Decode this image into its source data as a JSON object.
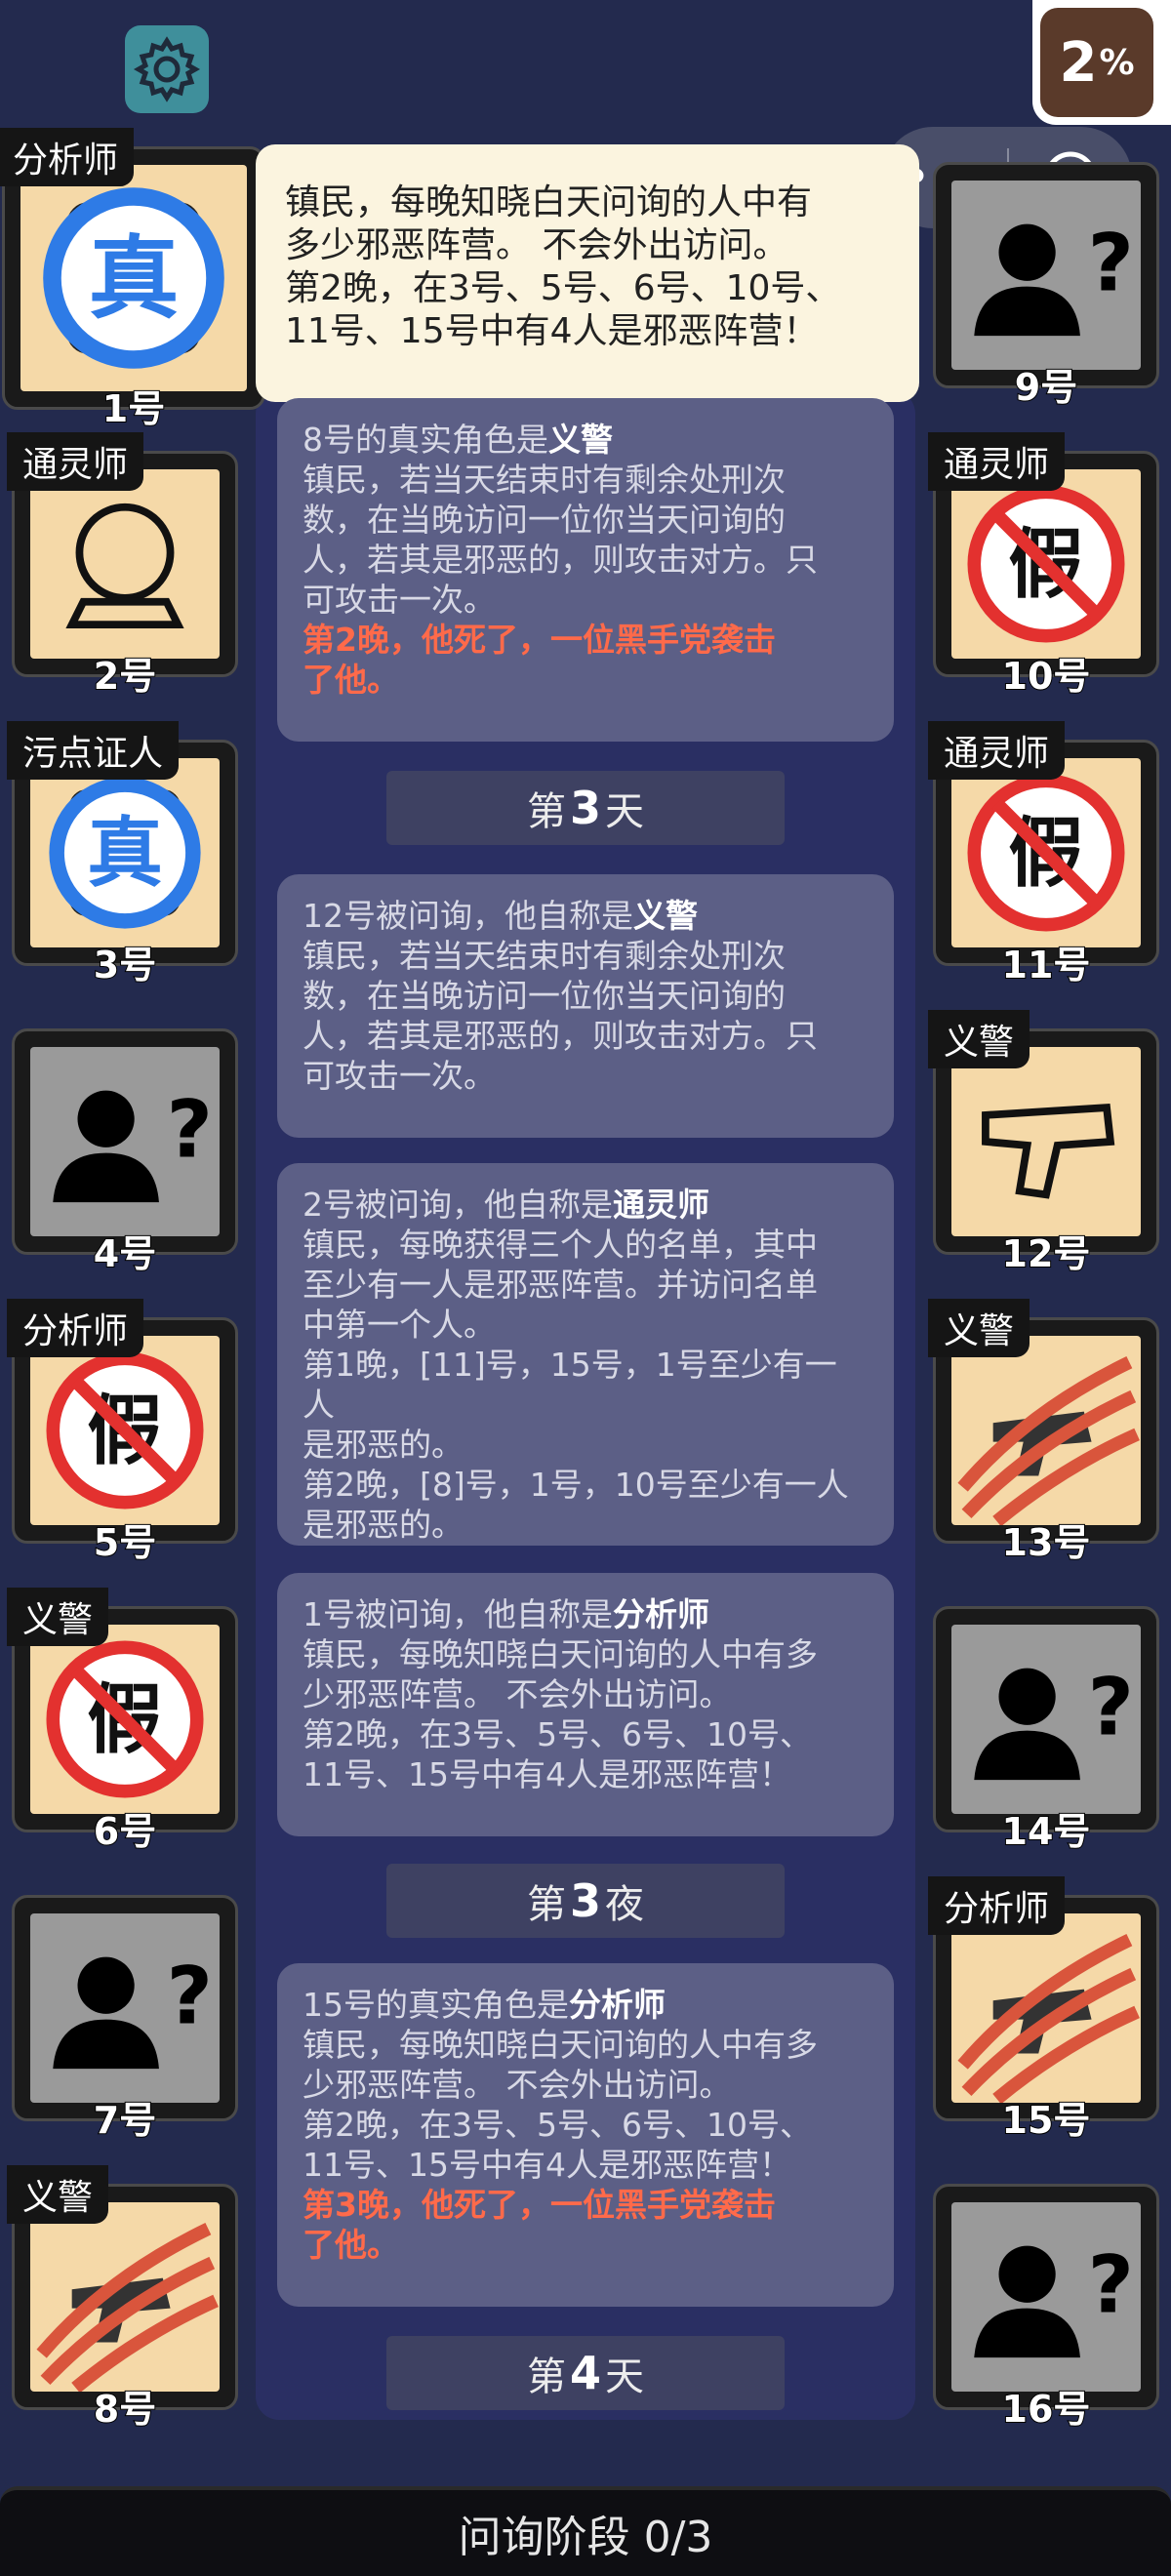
{
  "header": {
    "percent_value": "2",
    "percent_sign": "%",
    "capsule_more": "•••"
  },
  "tooltip": {
    "lines": [
      "镇民，每晚知晓白天问询的人中有",
      "多少邪恶阵营。 不会外出访问。",
      "第2晚，在3号、5号、6号、10号、",
      "11号、15号中有4人是邪恶阵营！"
    ]
  },
  "players": [
    {
      "num": "1号",
      "label": "分析师",
      "state": "true"
    },
    {
      "num": "2号",
      "label": "通灵师",
      "state": "role"
    },
    {
      "num": "3号",
      "label": "污点证人",
      "state": "true"
    },
    {
      "num": "4号",
      "label": "",
      "state": "unknown"
    },
    {
      "num": "5号",
      "label": "分析师",
      "state": "fake"
    },
    {
      "num": "6号",
      "label": "义警",
      "state": "fake"
    },
    {
      "num": "7号",
      "label": "",
      "state": "unknown"
    },
    {
      "num": "8号",
      "label": "义警",
      "state": "dead"
    },
    {
      "num": "9号",
      "label": "",
      "state": "unknown"
    },
    {
      "num": "10号",
      "label": "通灵师",
      "state": "fake"
    },
    {
      "num": "11号",
      "label": "通灵师",
      "state": "fake"
    },
    {
      "num": "12号",
      "label": "义警",
      "state": "role"
    },
    {
      "num": "13号",
      "label": "义警",
      "state": "dead"
    },
    {
      "num": "14号",
      "label": "",
      "state": "unknown"
    },
    {
      "num": "15号",
      "label": "分析师",
      "state": "dead"
    },
    {
      "num": "16号",
      "label": "",
      "state": "unknown"
    }
  ],
  "cards": [
    {
      "title_pre": "8号的真实角色是",
      "title_role": "义警",
      "lines": [
        "镇民，若当天结束时有剩余处刑次",
        "数，在当晚访问一位你当天问询的",
        "人，若其是邪恶的，则攻击对方。只",
        "可攻击一次。"
      ],
      "red": [
        "第2晚，他死了，一位黑手党袭击",
        "了他。"
      ]
    },
    {
      "title_pre": "12号被问询，他自称是",
      "title_role": "义警",
      "lines": [
        "镇民，若当天结束时有剩余处刑次",
        "数，在当晚访问一位你当天问询的",
        "人，若其是邪恶的，则攻击对方。只",
        "可攻击一次。"
      ],
      "red": []
    },
    {
      "title_pre": "2号被问询，他自称是",
      "title_role": "通灵师",
      "lines": [
        "镇民，每晚获得三个人的名单，其中",
        "至少有一人是邪恶阵营。并访问名单",
        "中第一个人。",
        "第1晚，[11]号，15号，1号至少有一人",
        "是邪恶的。",
        "第2晚，[8]号，1号，10号至少有一人",
        "是邪恶的。"
      ],
      "red": []
    },
    {
      "title_pre": "1号被问询，他自称是",
      "title_role": "分析师",
      "lines": [
        "镇民，每晚知晓白天问询的人中有多",
        "少邪恶阵营。 不会外出访问。",
        "第2晚，在3号、5号、6号、10号、",
        "11号、15号中有4人是邪恶阵营！"
      ],
      "red": []
    },
    {
      "title_pre": "15号的真实角色是",
      "title_role": "分析师",
      "lines": [
        "镇民，每晚知晓白天问询的人中有多",
        "少邪恶阵营。 不会外出访问。",
        "第2晚，在3号、5号、6号、10号、",
        "11号、15号中有4人是邪恶阵营！"
      ],
      "red": [
        "第3晚，他死了，一位黑手党袭击",
        "了他。"
      ]
    }
  ],
  "daybars": [
    {
      "pre": "第",
      "num": "3",
      "post": "天"
    },
    {
      "pre": "第",
      "num": "3",
      "post": "夜"
    },
    {
      "pre": "第",
      "num": "4",
      "post": "天"
    }
  ],
  "bottom_label": "问询阶段 0/3",
  "colors": {
    "background": "#232a4e",
    "card": "#5c5f86",
    "dead_red": "#ff6a4a",
    "stamp_blue": "#2e7be6",
    "stamp_red": "#e3312f"
  }
}
